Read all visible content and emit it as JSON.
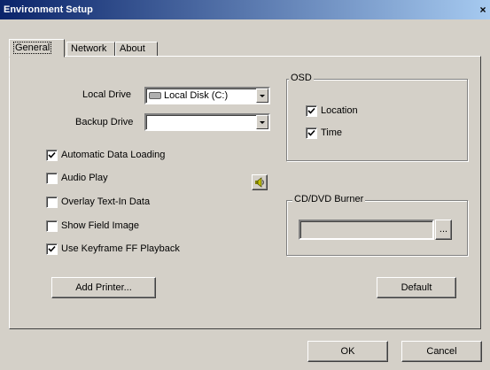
{
  "window": {
    "title": "Environment Setup",
    "close_glyph": "×"
  },
  "tabs": [
    {
      "label": "General",
      "active": true
    },
    {
      "label": "Network",
      "active": false
    },
    {
      "label": "About",
      "active": false
    }
  ],
  "general": {
    "local_drive": {
      "label": "Local Drive",
      "value": "Local Disk (C:)"
    },
    "backup_drive": {
      "label": "Backup Drive",
      "value": ""
    },
    "options": [
      {
        "label": "Automatic Data Loading",
        "checked": true
      },
      {
        "label": "Audio Play",
        "checked": false
      },
      {
        "label": "Overlay Text-In Data",
        "checked": false
      },
      {
        "label": "Show Field Image",
        "checked": false
      },
      {
        "label": "Use Keyframe FF Playback",
        "checked": true
      }
    ],
    "add_printer_label": "Add Printer...",
    "default_label": "Default",
    "osd": {
      "title": "OSD",
      "options": [
        {
          "label": "Location",
          "checked": true
        },
        {
          "label": "Time",
          "checked": true
        }
      ]
    },
    "burner": {
      "title": "CD/DVD Burner",
      "value": "",
      "browse_label": "..."
    }
  },
  "footer": {
    "ok_label": "OK",
    "cancel_label": "Cancel"
  },
  "icons": {
    "speaker": "speaker-icon",
    "disk": "hard-disk-icon"
  },
  "colors": {
    "title_start": "#0a246a",
    "title_end": "#a6caf0",
    "face": "#d4d0c8"
  }
}
